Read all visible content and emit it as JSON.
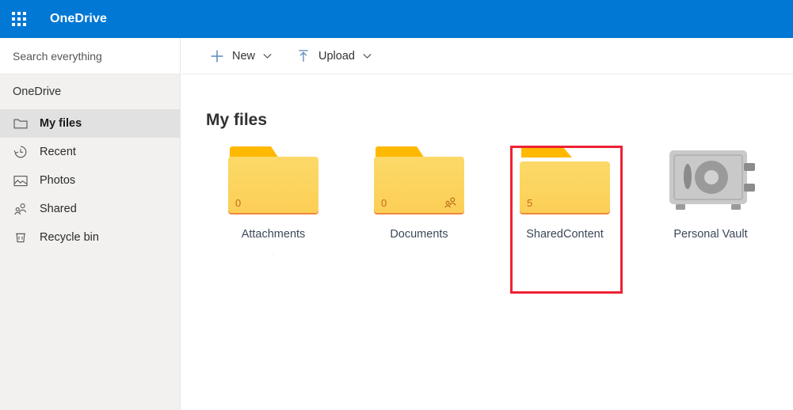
{
  "header": {
    "app_launcher_icon": "waffle-grid-icon",
    "brand": "OneDrive",
    "background": "#0078d4"
  },
  "sidebar": {
    "search": {
      "placeholder": "Search everything",
      "value": ""
    },
    "section_title": "OneDrive",
    "items": [
      {
        "label": "My files",
        "icon": "folder-icon",
        "selected": true
      },
      {
        "label": "Recent",
        "icon": "history-icon",
        "selected": false
      },
      {
        "label": "Photos",
        "icon": "photo-icon",
        "selected": false
      },
      {
        "label": "Shared",
        "icon": "people-icon",
        "selected": false
      },
      {
        "label": "Recycle bin",
        "icon": "recycle-bin-icon",
        "selected": false
      }
    ]
  },
  "command_bar": {
    "new": {
      "label": "New",
      "icon": "plus-icon",
      "caret": "chevron-down-icon"
    },
    "upload": {
      "label": "Upload",
      "icon": "upload-arrow-icon",
      "caret": "chevron-down-icon"
    }
  },
  "main": {
    "title": "My files",
    "tiles": [
      {
        "name": "Attachments",
        "type": "folder",
        "count": "0",
        "shared": false,
        "sublabel": "·",
        "highlighted": false
      },
      {
        "name": "Documents",
        "type": "folder",
        "count": "0",
        "shared": true,
        "shared_icon": "people-icon",
        "sublabel": "",
        "highlighted": false
      },
      {
        "name": "SharedContent",
        "type": "folder-open",
        "count": "5",
        "shared": false,
        "sublabel": "",
        "highlighted": true
      },
      {
        "name": "Personal Vault",
        "type": "vault",
        "count": "",
        "shared": false,
        "icon": "safe-vault-icon",
        "sublabel": "",
        "highlighted": false
      }
    ]
  },
  "annotation": {
    "shape": "rectangle",
    "color": "#ee2233",
    "target": "SharedContent"
  },
  "colors": {
    "brand_blue": "#0078d4",
    "sidebar_bg": "#f2f1f0",
    "selected_nav_bg": "#e1e1e1",
    "folder_yellow": "#fcd45e",
    "folder_tab_orange": "#ffb900",
    "folder_edge_orange": "#f08a3c",
    "vault_grey": "#c8c8c8",
    "annotation_red": "#ee2233"
  }
}
